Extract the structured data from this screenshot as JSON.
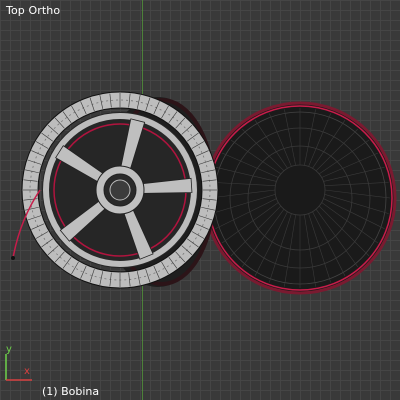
{
  "viewport": {
    "view_label": "Top Ortho",
    "object_label": "(1) Bobina",
    "colors": {
      "background": "#393939",
      "grid": "#464646",
      "y_axis_line": "#4f8a3a",
      "wire": "#000000",
      "selected_edge": "#c81c4a",
      "mesh_face": "#c8c8c8"
    }
  },
  "gizmo": {
    "y_label": "y",
    "x_label": "x"
  },
  "objects": [
    {
      "name": "wheel-left",
      "type": "mesh"
    },
    {
      "name": "disc-right",
      "type": "mesh"
    }
  ]
}
